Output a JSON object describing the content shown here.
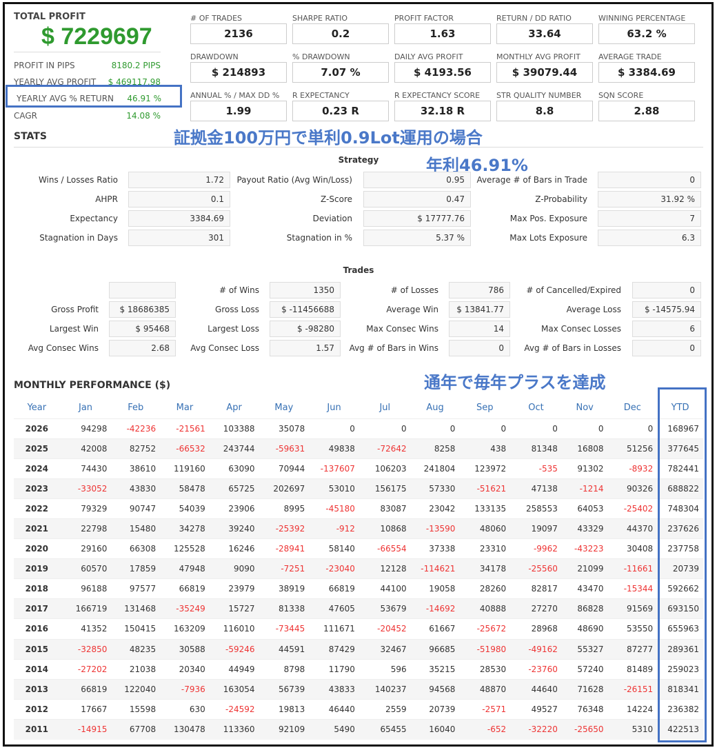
{
  "summary": {
    "total_profit_label": "TOTAL PROFIT",
    "total_profit_value": "$ 7229697",
    "rows": [
      {
        "label": "PROFIT IN PIPS",
        "value": "8180.2 PIPS"
      },
      {
        "label": "YEARLY AVG PROFIT",
        "value": "$ 469117.98"
      },
      {
        "label": "YEARLY AVG % RETURN",
        "value": "46.91 %"
      },
      {
        "label": "CAGR",
        "value": "14.08 %"
      }
    ]
  },
  "metrics": [
    [
      {
        "label": "# OF TRADES",
        "value": "2136"
      },
      {
        "label": "SHARPE RATIO",
        "value": "0.2"
      },
      {
        "label": "PROFIT FACTOR",
        "value": "1.63"
      },
      {
        "label": "RETURN / DD RATIO",
        "value": "33.64"
      },
      {
        "label": "WINNING PERCENTAGE",
        "value": "63.2 %"
      }
    ],
    [
      {
        "label": "DRAWDOWN",
        "value": "$ 214893"
      },
      {
        "label": "% DRAWDOWN",
        "value": "7.07 %"
      },
      {
        "label": "DAILY AVG PROFIT",
        "value": "$ 4193.56"
      },
      {
        "label": "MONTHLY AVG PROFIT",
        "value": "$ 39079.44"
      },
      {
        "label": "AVERAGE TRADE",
        "value": "$ 3384.69"
      }
    ],
    [
      {
        "label": "ANNUAL % / MAX DD %",
        "value": "1.99"
      },
      {
        "label": "R EXPECTANCY",
        "value": "0.23 R"
      },
      {
        "label": "R EXPECTANCY SCORE",
        "value": "32.18 R"
      },
      {
        "label": "STR QUALITY NUMBER",
        "value": "8.8"
      },
      {
        "label": "SQN SCORE",
        "value": "2.88"
      }
    ]
  ],
  "overlay": {
    "line1": "証拠金100万円で単利0.9Lot運用の場合",
    "line2": "年利46.91%",
    "line3": "通年で毎年プラスを達成"
  },
  "stats": {
    "title": "STATS",
    "strategy_title": "Strategy",
    "strategy": [
      [
        {
          "label": "Wins / Losses Ratio",
          "value": "1.72"
        },
        {
          "label": "Payout Ratio (Avg Win/Loss)",
          "value": "0.95"
        },
        {
          "label": "Average # of Bars in Trade",
          "value": "0"
        }
      ],
      [
        {
          "label": "AHPR",
          "value": "0.1"
        },
        {
          "label": "Z-Score",
          "value": "0.47"
        },
        {
          "label": "Z-Probability",
          "value": "31.92 %"
        }
      ],
      [
        {
          "label": "Expectancy",
          "value": "3384.69"
        },
        {
          "label": "Deviation",
          "value": "$ 17777.76"
        },
        {
          "label": "Max Pos. Exposure",
          "value": "7"
        }
      ],
      [
        {
          "label": "Stagnation in Days",
          "value": "301"
        },
        {
          "label": "Stagnation in %",
          "value": "5.37 %"
        },
        {
          "label": "Max Lots Exposure",
          "value": "6.3"
        }
      ]
    ],
    "trades_title": "Trades",
    "trades": [
      [
        {
          "label": "",
          "value": ""
        },
        {
          "label": "# of Wins",
          "value": "1350"
        },
        {
          "label": "# of Losses",
          "value": "786"
        },
        {
          "label": "# of Cancelled/Expired",
          "value": "0"
        }
      ],
      [
        {
          "label": "Gross Profit",
          "value": "$ 18686385"
        },
        {
          "label": "Gross Loss",
          "value": "$ -11456688"
        },
        {
          "label": "Average Win",
          "value": "$ 13841.77"
        },
        {
          "label": "Average Loss",
          "value": "$ -14575.94"
        }
      ],
      [
        {
          "label": "Largest Win",
          "value": "$ 95468"
        },
        {
          "label": "Largest Loss",
          "value": "$ -98280"
        },
        {
          "label": "Max Consec Wins",
          "value": "14"
        },
        {
          "label": "Max Consec Losses",
          "value": "6"
        }
      ],
      [
        {
          "label": "Avg Consec Wins",
          "value": "2.68"
        },
        {
          "label": "Avg Consec Loss",
          "value": "1.57"
        },
        {
          "label": "Avg # of Bars in Wins",
          "value": "0"
        },
        {
          "label": "Avg # of Bars in Losses",
          "value": "0"
        }
      ]
    ]
  },
  "monthly": {
    "title": "MONTHLY PERFORMANCE ($)",
    "headers": [
      "Year",
      "Jan",
      "Feb",
      "Mar",
      "Apr",
      "May",
      "Jun",
      "Jul",
      "Aug",
      "Sep",
      "Oct",
      "Nov",
      "Dec",
      "YTD"
    ],
    "rows": [
      [
        "2026",
        "94298",
        "-42236",
        "-21561",
        "103388",
        "35078",
        "0",
        "0",
        "0",
        "0",
        "0",
        "0",
        "0",
        "168967"
      ],
      [
        "2025",
        "42008",
        "82752",
        "-66532",
        "243744",
        "-59631",
        "49838",
        "-72642",
        "8258",
        "438",
        "81348",
        "16808",
        "51256",
        "377645"
      ],
      [
        "2024",
        "74430",
        "38610",
        "119160",
        "63090",
        "70944",
        "-137607",
        "106203",
        "241804",
        "123972",
        "-535",
        "91302",
        "-8932",
        "782441"
      ],
      [
        "2023",
        "-33052",
        "43830",
        "58478",
        "65725",
        "202697",
        "53010",
        "156175",
        "57330",
        "-51621",
        "47138",
        "-1214",
        "90326",
        "688822"
      ],
      [
        "2022",
        "79329",
        "90747",
        "54039",
        "23906",
        "8995",
        "-45180",
        "83087",
        "23042",
        "133135",
        "258553",
        "64053",
        "-25402",
        "748304"
      ],
      [
        "2021",
        "22798",
        "15480",
        "34278",
        "39240",
        "-25392",
        "-912",
        "10868",
        "-13590",
        "48060",
        "19097",
        "43329",
        "44370",
        "237626"
      ],
      [
        "2020",
        "29160",
        "66308",
        "125528",
        "16246",
        "-28941",
        "58140",
        "-66554",
        "37338",
        "23310",
        "-9962",
        "-43223",
        "30408",
        "237758"
      ],
      [
        "2019",
        "60570",
        "17859",
        "47948",
        "9090",
        "-7251",
        "-23040",
        "12128",
        "-114621",
        "34178",
        "-25560",
        "21099",
        "-11661",
        "20739"
      ],
      [
        "2018",
        "96188",
        "97577",
        "66819",
        "23979",
        "38919",
        "66819",
        "44100",
        "19058",
        "28260",
        "82817",
        "43470",
        "-15344",
        "592662"
      ],
      [
        "2017",
        "166719",
        "131468",
        "-35249",
        "15727",
        "81338",
        "47605",
        "53679",
        "-14692",
        "40888",
        "27270",
        "86828",
        "91569",
        "693150"
      ],
      [
        "2016",
        "41352",
        "150415",
        "163209",
        "116010",
        "-73445",
        "111671",
        "-20452",
        "61667",
        "-25672",
        "28968",
        "48690",
        "53550",
        "655963"
      ],
      [
        "2015",
        "-32850",
        "48235",
        "30588",
        "-59246",
        "44591",
        "87429",
        "32467",
        "96685",
        "-51980",
        "-49162",
        "55327",
        "87277",
        "289361"
      ],
      [
        "2014",
        "-27202",
        "21038",
        "20340",
        "44949",
        "8798",
        "11790",
        "596",
        "35215",
        "28530",
        "-23760",
        "57240",
        "81489",
        "259023"
      ],
      [
        "2013",
        "66819",
        "122040",
        "-7936",
        "163054",
        "56739",
        "43833",
        "140237",
        "94568",
        "48870",
        "44640",
        "71628",
        "-26151",
        "818341"
      ],
      [
        "2012",
        "17667",
        "15598",
        "630",
        "-24592",
        "19813",
        "46440",
        "2559",
        "20739",
        "-2571",
        "49527",
        "76348",
        "14224",
        "236382"
      ],
      [
        "2011",
        "-14915",
        "67708",
        "130478",
        "113360",
        "92109",
        "5490",
        "65455",
        "16040",
        "-652",
        "-32220",
        "-25650",
        "5310",
        "422513"
      ]
    ]
  }
}
